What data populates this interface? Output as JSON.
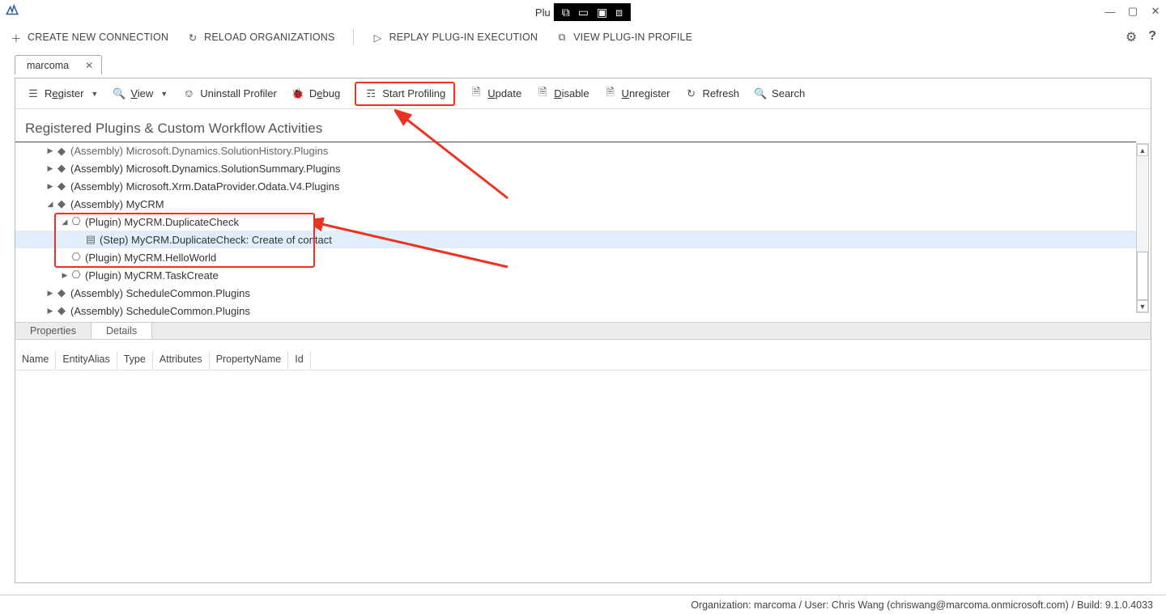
{
  "title": {
    "prefix": "Plu"
  },
  "window_buttons": {
    "minimize": "—",
    "maximize": "▢",
    "close": "✕"
  },
  "main_toolbar": {
    "create": "CREATE NEW CONNECTION",
    "reload": "RELOAD ORGANIZATIONS",
    "replay": "REPLAY PLUG-IN EXECUTION",
    "view_profile": "VIEW PLUG-IN PROFILE"
  },
  "doc_tab": {
    "label": "marcoma"
  },
  "sec_toolbar": {
    "register": {
      "pre": "R",
      "u": "e",
      "post": "gister"
    },
    "view": {
      "pre": "",
      "u": "V",
      "post": "iew"
    },
    "uninstall": "Uninstall Profiler",
    "debug": {
      "pre": "D",
      "u": "e",
      "post": "bug"
    },
    "start_profiling": "Start Profiling",
    "update": {
      "pre": "",
      "u": "U",
      "post": "pdate"
    },
    "disable": {
      "pre": "",
      "u": "D",
      "post": "isable"
    },
    "unregister": {
      "pre": "",
      "u": "U",
      "post": "nregister"
    },
    "refresh": "Refresh",
    "search": "Search"
  },
  "tree": {
    "title": "Registered Plugins & Custom Workflow Activities",
    "items": [
      {
        "indent": 1,
        "exp": "▶",
        "kind": "assembly",
        "label": "(Assembly) Microsoft.Dynamics.SolutionHistory.Plugins",
        "cut": true
      },
      {
        "indent": 1,
        "exp": "▶",
        "kind": "assembly",
        "label": "(Assembly) Microsoft.Dynamics.SolutionSummary.Plugins"
      },
      {
        "indent": 1,
        "exp": "▶",
        "kind": "assembly",
        "label": "(Assembly) Microsoft.Xrm.DataProvider.Odata.V4.Plugins"
      },
      {
        "indent": 1,
        "exp": "◢",
        "kind": "assembly",
        "label": "(Assembly) MyCRM"
      },
      {
        "indent": 2,
        "exp": "◢",
        "kind": "plugin",
        "label": "(Plugin) MyCRM.DuplicateCheck"
      },
      {
        "indent": 3,
        "exp": "",
        "kind": "step",
        "label": "(Step) MyCRM.DuplicateCheck: Create of contact",
        "selected": true
      },
      {
        "indent": 2,
        "exp": "",
        "kind": "plugin",
        "label": "(Plugin) MyCRM.HelloWorld"
      },
      {
        "indent": 2,
        "exp": "▶",
        "kind": "plugin",
        "label": "(Plugin) MyCRM.TaskCreate"
      },
      {
        "indent": 1,
        "exp": "▶",
        "kind": "assembly",
        "label": "(Assembly) ScheduleCommon.Plugins"
      },
      {
        "indent": 1,
        "exp": "▶",
        "kind": "assembly",
        "label": "(Assembly) ScheduleCommon.Plugins"
      }
    ]
  },
  "bottom_tabs": {
    "properties": "Properties",
    "details": "Details"
  },
  "grid_columns": [
    "Name",
    "EntityAlias",
    "Type",
    "Attributes",
    "PropertyName",
    "Id"
  ],
  "status": "Organization: marcoma / User: Chris Wang (chriswang@marcoma.onmicrosoft.com) / Build: 9.1.0.4033"
}
